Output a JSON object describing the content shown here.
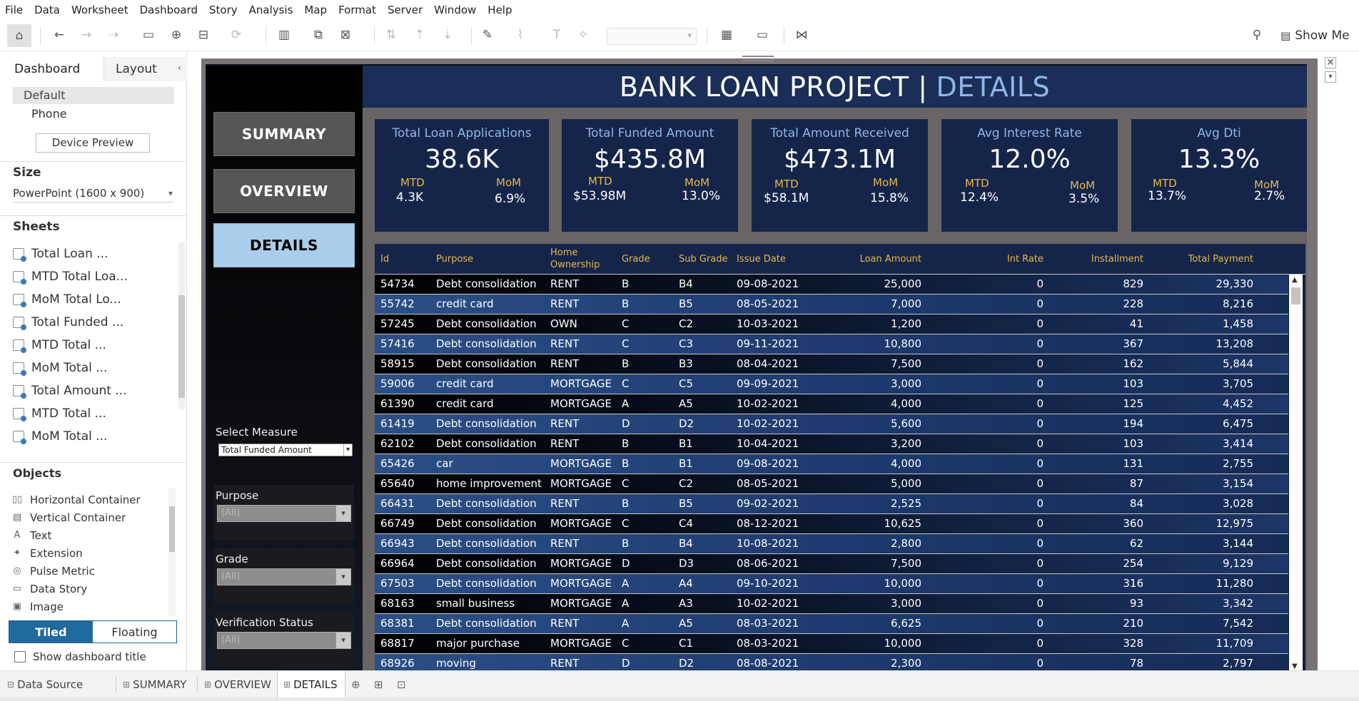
{
  "menu": [
    "File",
    "Data",
    "Worksheet",
    "Dashboard",
    "Story",
    "Analysis",
    "Map",
    "Format",
    "Server",
    "Window",
    "Help"
  ],
  "toolbar": {
    "show_me": "Show Me"
  },
  "left_panel": {
    "tab_dashboard": "Dashboard",
    "tab_layout": "Layout",
    "device_default": "Default",
    "device_phone": "Phone",
    "device_preview": "Device Preview",
    "size_heading": "Size",
    "size_value": "PowerPoint (1600 x 900)",
    "sheets_heading": "Sheets",
    "sheets": [
      "Total Loan ...",
      "MTD Total Loa...",
      "MoM Total Lo...",
      "Total Funded ...",
      "MTD Total ...",
      "MoM Total ...",
      "Total Amount ...",
      "MTD Total ...",
      "MoM Total ..."
    ],
    "objects_heading": "Objects",
    "objects": [
      {
        "label": "Horizontal Container",
        "icon": "horizontal-container-icon",
        "glyph": "▯▯"
      },
      {
        "label": "Vertical Container",
        "icon": "vertical-container-icon",
        "glyph": "▤"
      },
      {
        "label": "Text",
        "icon": "text-icon",
        "glyph": "A"
      },
      {
        "label": "Extension",
        "icon": "extension-icon",
        "glyph": "✦"
      },
      {
        "label": "Pulse Metric",
        "icon": "pulse-metric-icon",
        "glyph": "◎"
      },
      {
        "label": "Data Story",
        "icon": "data-story-icon",
        "glyph": "▭"
      },
      {
        "label": "Image",
        "icon": "image-icon",
        "glyph": "▣"
      }
    ],
    "tiled": "Tiled",
    "floating": "Floating",
    "show_title": "Show dashboard title"
  },
  "dashboard": {
    "title_main": "BANK LOAN PROJECT |",
    "title_highlight": "DETAILS",
    "nav": [
      "SUMMARY",
      "OVERVIEW",
      "DETAILS"
    ],
    "select_measure_label": "Select Measure",
    "select_measure_value": "Total Funded Amount",
    "filters": [
      {
        "label": "Purpose",
        "value": "(All)"
      },
      {
        "label": "Grade",
        "value": "(All)"
      },
      {
        "label": "Verification Status",
        "value": "(All)"
      }
    ],
    "kpis": [
      {
        "title": "Total Loan Applications",
        "value": "38.6K",
        "mtd_label": "MTD",
        "mtd": "4.3K",
        "mom_label": "MoM",
        "mom": "6.9%"
      },
      {
        "title": "Total Funded Amount",
        "value": "$435.8M",
        "mtd_label": "MTD",
        "mtd": "$53.98M",
        "mom_label": "MoM",
        "mom": "13.0%"
      },
      {
        "title": "Total Amount Received",
        "value": "$473.1M",
        "mtd_label": "MTD",
        "mtd": "$58.1M",
        "mom_label": "MoM",
        "mom": "15.8%"
      },
      {
        "title": "Avg Interest Rate",
        "value": "12.0%",
        "mtd_label": "MTD",
        "mtd": "12.4%",
        "mom_label": "MoM",
        "mom": "3.5%"
      },
      {
        "title": "Avg Dti",
        "value": "13.3%",
        "mtd_label": "MTD",
        "mtd": "13.7%",
        "mom_label": "MoM",
        "mom": "2.7%"
      }
    ],
    "table": {
      "headers": [
        "Id",
        "Purpose",
        "Home Ownership",
        "Grade",
        "Sub Grade",
        "Issue Date",
        "Loan Amount",
        "Int Rate",
        "Installment",
        "Total Payment"
      ],
      "rows": [
        [
          "54734",
          "Debt consolidation",
          "RENT",
          "B",
          "B4",
          "09-08-2021",
          "25,000",
          "0",
          "829",
          "29,330"
        ],
        [
          "55742",
          "credit card",
          "RENT",
          "B",
          "B5",
          "08-05-2021",
          "7,000",
          "0",
          "228",
          "8,216"
        ],
        [
          "57245",
          "Debt consolidation",
          "OWN",
          "C",
          "C2",
          "10-03-2021",
          "1,200",
          "0",
          "41",
          "1,458"
        ],
        [
          "57416",
          "Debt consolidation",
          "RENT",
          "C",
          "C3",
          "09-11-2021",
          "10,800",
          "0",
          "367",
          "13,208"
        ],
        [
          "58915",
          "Debt consolidation",
          "RENT",
          "B",
          "B3",
          "08-04-2021",
          "7,500",
          "0",
          "162",
          "5,844"
        ],
        [
          "59006",
          "credit card",
          "MORTGAGE",
          "C",
          "C5",
          "09-09-2021",
          "3,000",
          "0",
          "103",
          "3,705"
        ],
        [
          "61390",
          "credit card",
          "MORTGAGE",
          "A",
          "A5",
          "10-02-2021",
          "4,000",
          "0",
          "125",
          "4,452"
        ],
        [
          "61419",
          "Debt consolidation",
          "RENT",
          "D",
          "D2",
          "10-02-2021",
          "5,600",
          "0",
          "194",
          "6,475"
        ],
        [
          "62102",
          "Debt consolidation",
          "RENT",
          "B",
          "B1",
          "10-04-2021",
          "3,200",
          "0",
          "103",
          "3,414"
        ],
        [
          "65426",
          "car",
          "MORTGAGE",
          "B",
          "B1",
          "09-08-2021",
          "4,000",
          "0",
          "131",
          "2,755"
        ],
        [
          "65640",
          "home improvement",
          "MORTGAGE",
          "C",
          "C2",
          "08-05-2021",
          "5,000",
          "0",
          "87",
          "3,154"
        ],
        [
          "66431",
          "Debt consolidation",
          "RENT",
          "B",
          "B5",
          "09-02-2021",
          "2,525",
          "0",
          "84",
          "3,028"
        ],
        [
          "66749",
          "Debt consolidation",
          "MORTGAGE",
          "C",
          "C4",
          "08-12-2021",
          "10,625",
          "0",
          "360",
          "12,975"
        ],
        [
          "66943",
          "Debt consolidation",
          "RENT",
          "B",
          "B4",
          "10-08-2021",
          "2,800",
          "0",
          "62",
          "3,144"
        ],
        [
          "66964",
          "Debt consolidation",
          "MORTGAGE",
          "D",
          "D3",
          "08-06-2021",
          "7,500",
          "0",
          "254",
          "9,129"
        ],
        [
          "67503",
          "Debt consolidation",
          "MORTGAGE",
          "A",
          "A4",
          "09-10-2021",
          "10,000",
          "0",
          "316",
          "11,280"
        ],
        [
          "68163",
          "small business",
          "MORTGAGE",
          "A",
          "A3",
          "10-02-2021",
          "3,000",
          "0",
          "93",
          "3,342"
        ],
        [
          "68381",
          "Debt consolidation",
          "RENT",
          "A",
          "A5",
          "08-03-2021",
          "6,625",
          "0",
          "210",
          "7,542"
        ],
        [
          "68817",
          "major purchase",
          "MORTGAGE",
          "C",
          "C1",
          "08-03-2021",
          "10,000",
          "0",
          "328",
          "11,709"
        ],
        [
          "68926",
          "moving",
          "RENT",
          "D",
          "D2",
          "08-08-2021",
          "2,300",
          "0",
          "78",
          "2,797"
        ]
      ]
    }
  },
  "bottom_tabs": {
    "data_source": "Data Source",
    "sheets": [
      "SUMMARY",
      "OVERVIEW",
      "DETAILS"
    ],
    "active": "DETAILS"
  }
}
